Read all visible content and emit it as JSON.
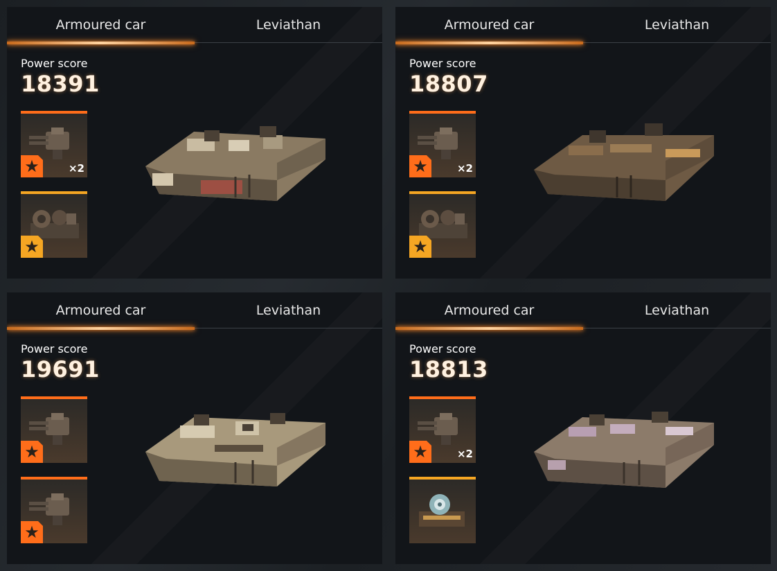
{
  "panels": [
    {
      "tabs": [
        "Armoured car",
        "Leviathan"
      ],
      "active_tab": 0,
      "power_label": "Power score",
      "power_value": "18391",
      "cards": [
        {
          "icon": "turret-icon",
          "tier": "orange",
          "count": "×2"
        },
        {
          "icon": "engine-icon",
          "tier": "gold",
          "count": ""
        }
      ]
    },
    {
      "tabs": [
        "Armoured car",
        "Leviathan"
      ],
      "active_tab": 0,
      "power_label": "Power score",
      "power_value": "18807",
      "cards": [
        {
          "icon": "turret-icon",
          "tier": "orange",
          "count": "×2"
        },
        {
          "icon": "engine-icon",
          "tier": "gold",
          "count": ""
        }
      ]
    },
    {
      "tabs": [
        "Armoured car",
        "Leviathan"
      ],
      "active_tab": 0,
      "power_label": "Power score",
      "power_value": "19691",
      "cards": [
        {
          "icon": "turret-icon",
          "tier": "orange",
          "count": ""
        },
        {
          "icon": "turret-icon",
          "tier": "orange",
          "count": ""
        }
      ]
    },
    {
      "tabs": [
        "Armoured car",
        "Leviathan"
      ],
      "active_tab": 0,
      "power_label": "Power score",
      "power_value": "18813",
      "cards": [
        {
          "icon": "turret-icon",
          "tier": "orange",
          "count": "×2"
        },
        {
          "icon": "machine-icon",
          "tier": "gold",
          "count": ""
        }
      ]
    }
  ],
  "colors": {
    "accent": "#ff6d1a",
    "gold": "#f5a623",
    "panel_bg": "#121519"
  }
}
